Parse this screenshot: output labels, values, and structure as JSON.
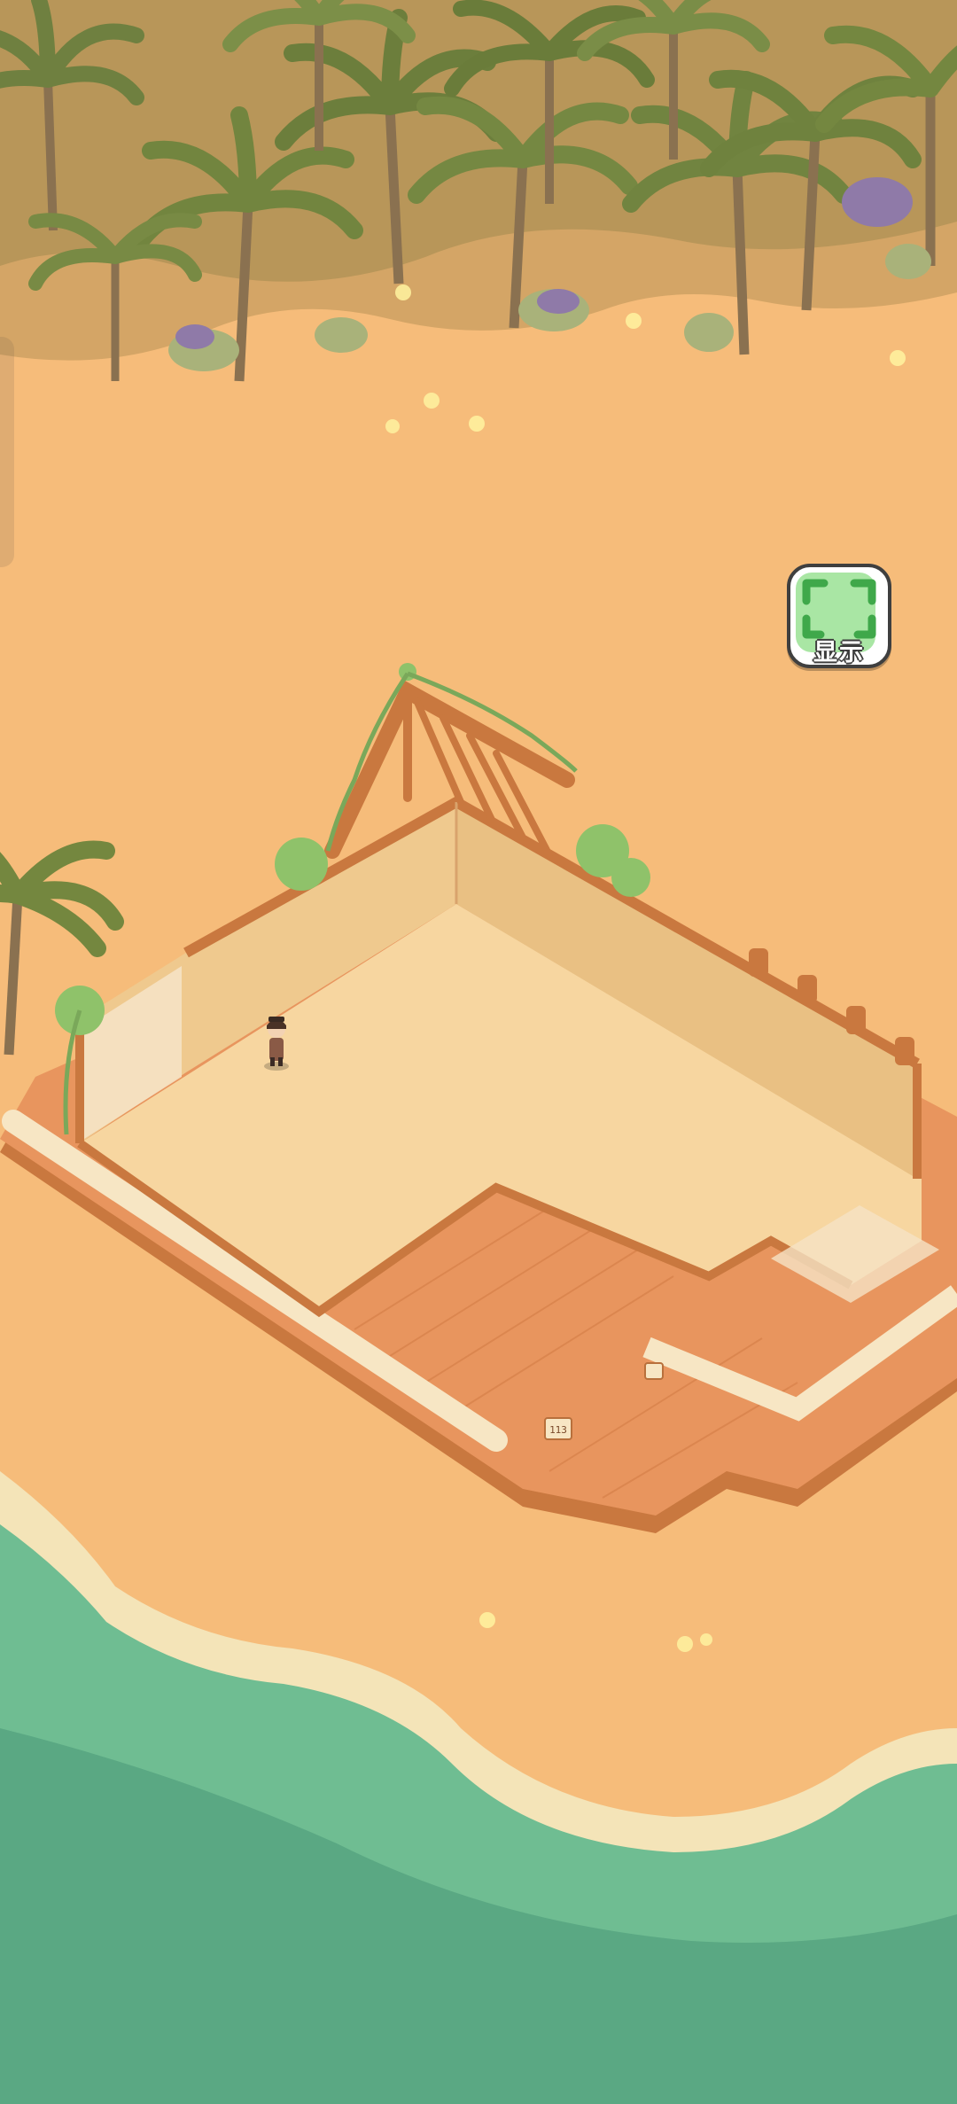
{
  "hud": {
    "display_button_label": "显示",
    "display_button_icon": "expand-corners-icon"
  },
  "world": {
    "scene": "beach-construction-site",
    "sign_code": "113",
    "colors": {
      "sand": "#f6bc7a",
      "sea": "#6fbd92",
      "foam": "#f4e4b8",
      "floor": "#f7d6a0",
      "wall": "#efc98e",
      "deck": "#e8955e",
      "beam": "#c9783f",
      "palm": "#7e8e4a"
    }
  }
}
